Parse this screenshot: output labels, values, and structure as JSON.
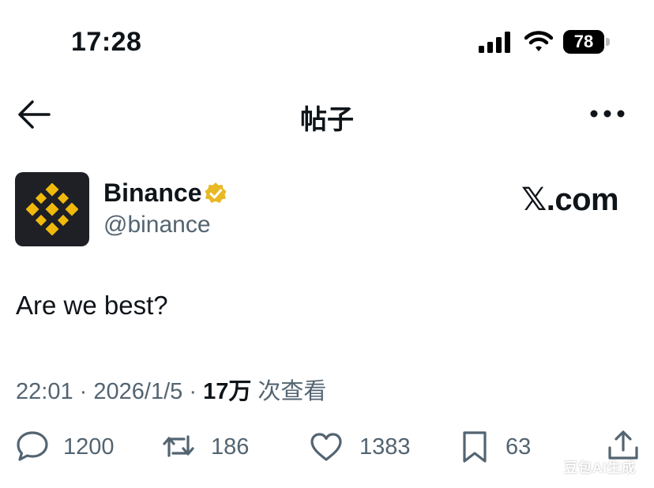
{
  "status_bar": {
    "time": "17:28",
    "battery": "78"
  },
  "nav": {
    "title": "帖子",
    "back_icon": "arrow-left-icon",
    "more_icon": "more-horizontal-icon"
  },
  "author": {
    "display_name": "Binance",
    "handle": "@binance",
    "verified_color": "#e8b923",
    "avatar_bg": "#1e2026",
    "logo_color": "#f0b90b"
  },
  "site_label": "𝕏.com",
  "post": {
    "text": "Are we best?",
    "time": "22:01",
    "date": "2026/1/5",
    "separator": "·",
    "views": "17万",
    "views_label": "次查看"
  },
  "actions": {
    "replies": "1200",
    "reposts": "186",
    "likes": "1383",
    "bookmarks": "63"
  },
  "watermark": "豆包AI生成"
}
